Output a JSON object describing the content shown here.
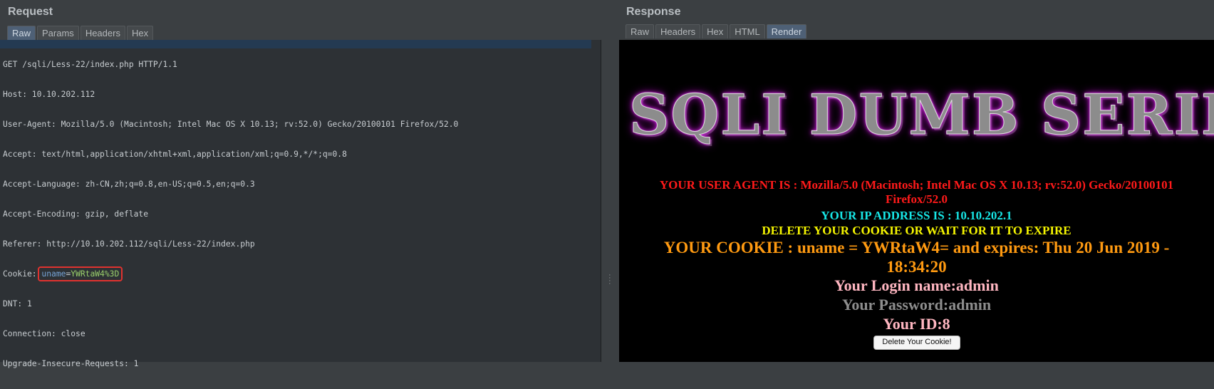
{
  "request": {
    "title": "Request",
    "tabs": [
      "Raw",
      "Params",
      "Headers",
      "Hex"
    ],
    "active_tab": "Raw",
    "lines": [
      "GET /sqli/Less-22/index.php HTTP/1.1",
      "Host: 10.10.202.112",
      "User-Agent: Mozilla/5.0 (Macintosh; Intel Mac OS X 10.13; rv:52.0) Gecko/20100101 Firefox/52.0",
      "Accept: text/html,application/xhtml+xml,application/xml;q=0.9,*/*;q=0.8",
      "Accept-Language: zh-CN,zh;q=0.8,en-US;q=0.5,en;q=0.3",
      "Accept-Encoding: gzip, deflate",
      "Referer: http://10.10.202.112/sqli/Less-22/index.php",
      "DNT: 1",
      "Connection: close",
      "Upgrade-Insecure-Requests: 1"
    ],
    "cookie": {
      "label": "Cookie: ",
      "name": "uname",
      "eq": "=",
      "value": "YWRtaW4%3D"
    }
  },
  "response": {
    "title": "Response",
    "tabs": [
      "Raw",
      "Headers",
      "Hex",
      "HTML",
      "Render"
    ],
    "active_tab": "Render",
    "render": {
      "banner": "SQLI DUMB SERIES",
      "user_agent": "YOUR USER AGENT IS : Mozilla/5.0 (Macintosh; Intel Mac OS X 10.13; rv:52.0) Gecko/20100101 Firefox/52.0",
      "ip": "YOUR IP ADDRESS IS : 10.10.202.1",
      "delete_notice": "DELETE YOUR COOKIE OR WAIT FOR IT TO EXPIRE",
      "cookie": "YOUR COOKIE : uname = YWRtaW4= and expires: Thu 20 Jun 2019 - 18:34:20",
      "login": "Your Login name:admin",
      "password": "Your Password:admin",
      "id": "Your ID:8",
      "delete_button": "Delete Your Cookie!"
    }
  },
  "colors": {
    "background": "#3b3f42",
    "editor_bg": "#2d3135",
    "active_tab": "#4e6076",
    "cookie_value": "#9ad06b",
    "highlight_border": "#e0322f"
  }
}
